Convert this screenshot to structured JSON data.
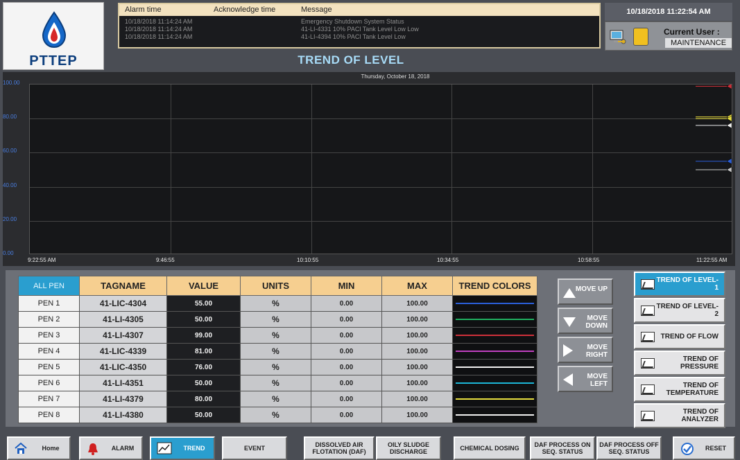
{
  "header": {
    "brand": "PTTEP",
    "alarm_columns": {
      "time": "Alarm time",
      "ack": "Acknowledge time",
      "message": "Message"
    },
    "alarms": [
      {
        "time": "10/18/2018 11:14:24 AM",
        "ack": "",
        "message": "Emergency Shutdown System Status"
      },
      {
        "time": "10/18/2018 11:14:24 AM",
        "ack": "",
        "message": "41-LI-4331 10% PACl Tank Level Low Low"
      },
      {
        "time": "10/18/2018 11:14:24 AM",
        "ack": "",
        "message": "41-LI-4394 10% PACl Tank Level Low"
      }
    ],
    "title": "TREND OF LEVEL",
    "datetime": "10/18/2018 11:22:54 AM",
    "user_label": "Current User :",
    "user_name": "MAINTENANCE"
  },
  "chart_data": {
    "type": "line",
    "date_caption": "Thursday, October 18, 2018",
    "y_ticks": [
      "100.00",
      "80.00",
      "60.00",
      "40.00",
      "20.00",
      "0.00"
    ],
    "ylim": [
      0,
      100
    ],
    "x_ticks": [
      "9:22:55 AM",
      "9:46:55",
      "10:10:55",
      "10:34:55",
      "10:58:55",
      "11:22:55 AM"
    ],
    "series": [
      {
        "tag": "41-LIC-4304",
        "color": "#2b5fd9",
        "y": 55
      },
      {
        "tag": "41-LI-4305",
        "color": "#20b060",
        "y": 50
      },
      {
        "tag": "41-LI-4307",
        "color": "#d0303a",
        "y": 99
      },
      {
        "tag": "41-LIC-4339",
        "color": "#f0e040",
        "y": 81
      },
      {
        "tag": "41-LIC-4350",
        "color": "#f2f2f2",
        "y": 76
      },
      {
        "tag": "41-LI-4351",
        "color": "#1cb8d8",
        "y": 50
      },
      {
        "tag": "41-LI-4379",
        "color": "#e8e040",
        "y": 80
      },
      {
        "tag": "41-LI-4380",
        "color": "#c8c8c8",
        "y": 50
      }
    ]
  },
  "table": {
    "all_pen": "ALL PEN",
    "headers": {
      "tagname": "TAGNAME",
      "value": "VALUE",
      "units": "UNITS",
      "min": "MIN",
      "max": "MAX",
      "colors": "TREND COLORS"
    },
    "rows": [
      {
        "pen": "PEN 1",
        "tag": "41-LIC-4304",
        "value": "55.00",
        "units": "%",
        "min": "0.00",
        "max": "100.00",
        "color": "#2b5fd9"
      },
      {
        "pen": "PEN 2",
        "tag": "41-LI-4305",
        "value": "50.00",
        "units": "%",
        "min": "0.00",
        "max": "100.00",
        "color": "#20b060"
      },
      {
        "pen": "PEN 3",
        "tag": "41-LI-4307",
        "value": "99.00",
        "units": "%",
        "min": "0.00",
        "max": "100.00",
        "color": "#d0303a"
      },
      {
        "pen": "PEN 4",
        "tag": "41-LIC-4339",
        "value": "81.00",
        "units": "%",
        "min": "0.00",
        "max": "100.00",
        "color": "#c040c0"
      },
      {
        "pen": "PEN 5",
        "tag": "41-LIC-4350",
        "value": "76.00",
        "units": "%",
        "min": "0.00",
        "max": "100.00",
        "color": "#f2f2f2"
      },
      {
        "pen": "PEN 6",
        "tag": "41-LI-4351",
        "value": "50.00",
        "units": "%",
        "min": "0.00",
        "max": "100.00",
        "color": "#1cb8d8"
      },
      {
        "pen": "PEN 7",
        "tag": "41-LI-4379",
        "value": "80.00",
        "units": "%",
        "min": "0.00",
        "max": "100.00",
        "color": "#e8e040"
      },
      {
        "pen": "PEN 8",
        "tag": "41-LI-4380",
        "value": "50.00",
        "units": "%",
        "min": "0.00",
        "max": "100.00",
        "color": "#f2f2f2"
      }
    ]
  },
  "move_buttons": [
    {
      "label": "MOVE UP",
      "dir": "up"
    },
    {
      "label": "MOVE DOWN",
      "dir": "down"
    },
    {
      "label": "MOVE RIGHT",
      "dir": "right"
    },
    {
      "label": "MOVE LEFT",
      "dir": "left"
    }
  ],
  "trend_buttons": [
    {
      "label": "TREND OF LEVEL-1",
      "active": true
    },
    {
      "label": "TREND OF LEVEL-2",
      "active": false
    },
    {
      "label": "TREND OF FLOW",
      "active": false
    },
    {
      "label": "TREND OF PRESSURE",
      "active": false
    },
    {
      "label": "TREND OF TEMPERATURE",
      "active": false
    },
    {
      "label": "TREND OF ANALYZER",
      "active": false
    }
  ],
  "nav": [
    {
      "label": "Home",
      "icon": "home-icon",
      "active": false
    },
    {
      "label": "ALARM",
      "icon": "bell-icon",
      "active": false
    },
    {
      "label": "TREND",
      "icon": "trend-icon",
      "active": true
    },
    {
      "label": "EVENT",
      "icon": "",
      "active": false
    },
    {
      "label": "DISSOLVED AIR FLOTATION (DAF)",
      "icon": "",
      "active": false
    },
    {
      "label": "OILY SLUDGE DISCHARGE",
      "icon": "",
      "active": false
    },
    {
      "label": "CHEMICAL DOSING",
      "icon": "",
      "active": false
    },
    {
      "label": "DAF PROCESS ON SEQ. STATUS",
      "icon": "",
      "active": false
    },
    {
      "label": "DAF PROCESS OFF SEQ. STATUS",
      "icon": "",
      "active": false
    },
    {
      "label": "RESET",
      "icon": "reset-icon",
      "active": false
    }
  ]
}
